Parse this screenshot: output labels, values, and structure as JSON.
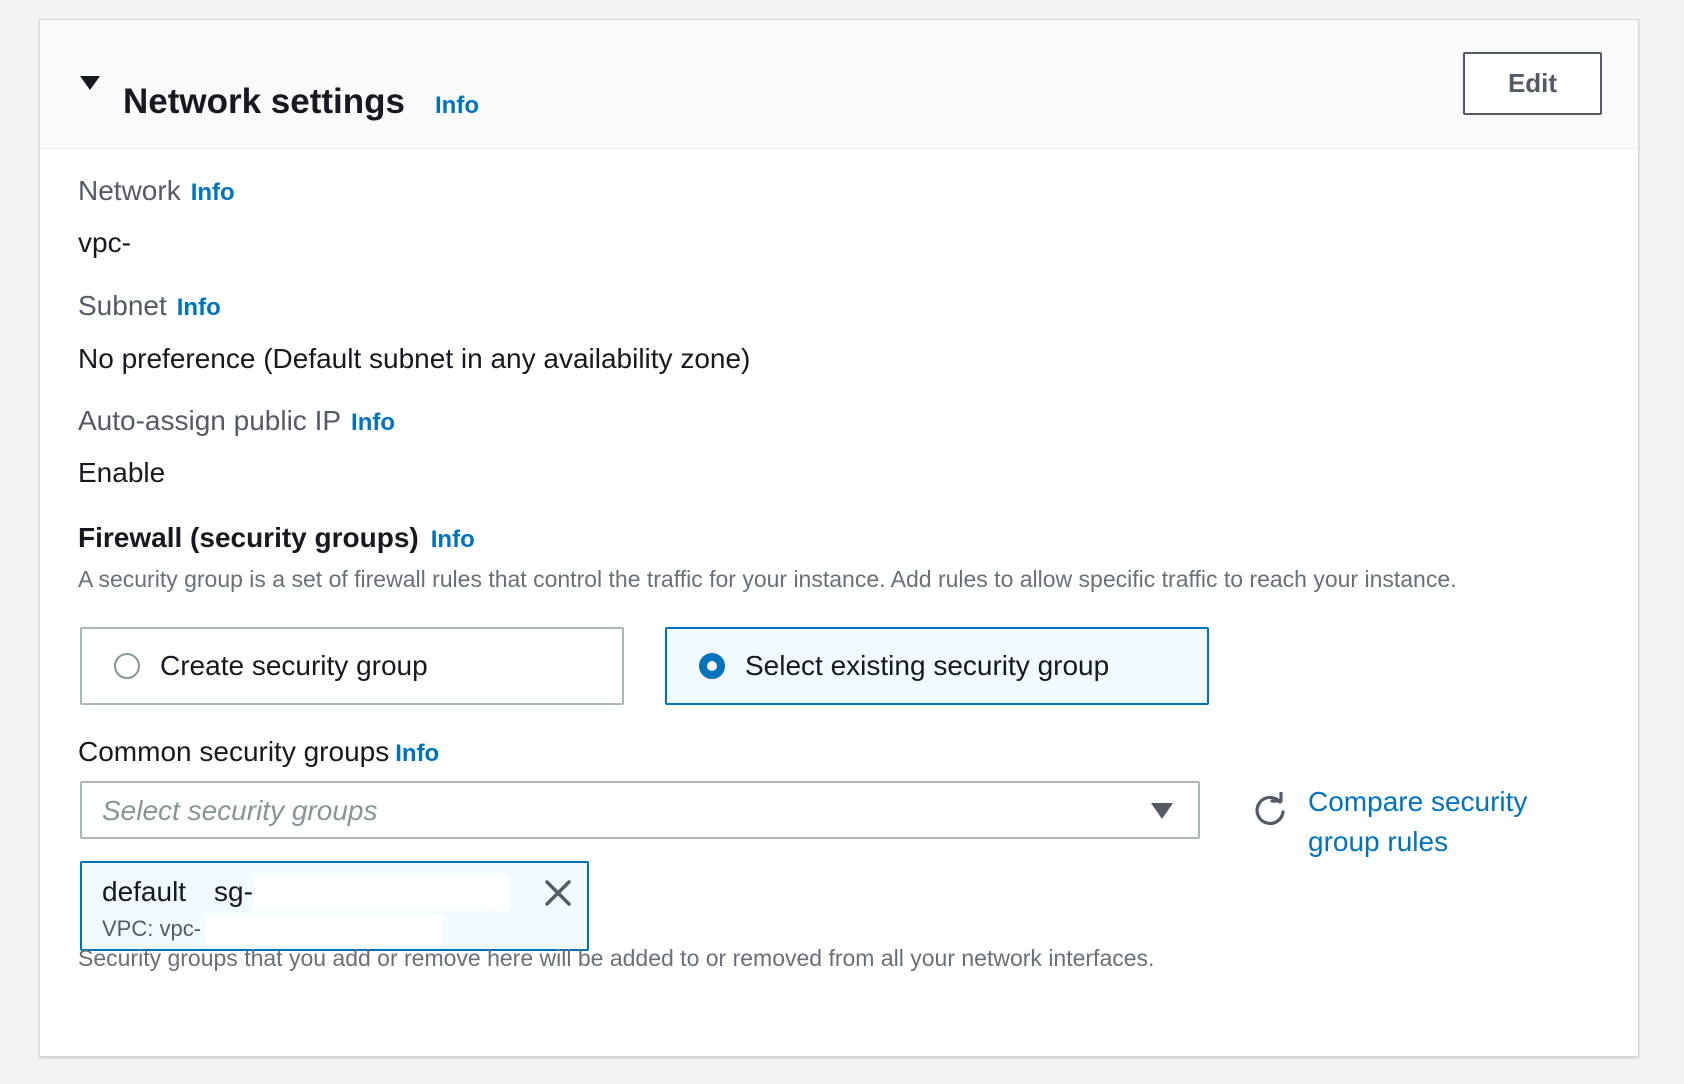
{
  "header": {
    "title": "Network settings",
    "info": "Info",
    "edit_label": "Edit"
  },
  "fields": {
    "network": {
      "label": "Network",
      "info": "Info",
      "value": "vpc-"
    },
    "subnet": {
      "label": "Subnet",
      "info": "Info",
      "value": "No preference (Default subnet in any availability zone)"
    },
    "public_ip": {
      "label": "Auto-assign public IP",
      "info": "Info",
      "value": "Enable"
    }
  },
  "firewall": {
    "title": "Firewall (security groups)",
    "info": "Info",
    "description": "A security group is a set of firewall rules that control the traffic for your instance. Add rules to allow specific traffic to reach your instance.",
    "options": [
      {
        "label": "Create security group",
        "selected": false
      },
      {
        "label": "Select existing security group",
        "selected": true
      }
    ]
  },
  "common_groups": {
    "label": "Common security groups",
    "info": "Info",
    "placeholder": "Select security groups",
    "compare_link": "Compare security group rules",
    "selected": {
      "name": "default",
      "id": "sg-",
      "vpc": "VPC: vpc-"
    },
    "note": "Security groups that you add or remove here will be added to or removed from all your network interfaces."
  },
  "colors": {
    "link": "#0073bb",
    "selected_border": "#0073bb",
    "selected_bg": "#f1faff"
  }
}
